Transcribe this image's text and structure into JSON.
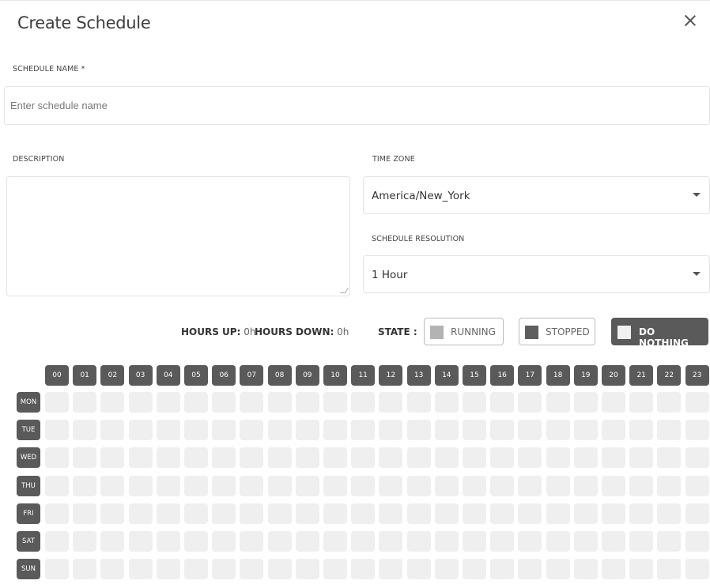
{
  "dialog": {
    "title": "Create Schedule"
  },
  "form": {
    "schedule_name_label": "SCHEDULE NAME *",
    "schedule_name_placeholder": "Enter schedule name",
    "schedule_name_value": "",
    "description_label": "DESCRIPTION",
    "description_value": "",
    "time_zone_label": "TIME ZONE",
    "time_zone_value": "America/New_York",
    "resolution_label": "SCHEDULE RESOLUTION",
    "resolution_value": "1 Hour"
  },
  "summary": {
    "hours_up_label": "HOURS UP:",
    "hours_up_value": "0h",
    "hours_down_label": "HOURS DOWN:",
    "hours_down_value": "0h",
    "state_label": "STATE :"
  },
  "states": {
    "running": "RUNNING",
    "stopped": "STOPPED",
    "do_nothing": "DO NOTHING",
    "selected": "DO NOTHING"
  },
  "grid": {
    "hours": [
      "00",
      "01",
      "02",
      "03",
      "04",
      "05",
      "06",
      "07",
      "08",
      "09",
      "10",
      "11",
      "12",
      "13",
      "14",
      "15",
      "16",
      "17",
      "18",
      "19",
      "20",
      "21",
      "22",
      "23"
    ],
    "days": [
      "MON",
      "TUE",
      "WED",
      "THU",
      "FRI",
      "SAT",
      "SUN"
    ]
  },
  "colors": {
    "dark_cell": "#5a5a5a",
    "empty_cell": "#efefef",
    "running_swatch": "#b3b3b3",
    "stopped_swatch": "#5e5e5e"
  },
  "icons": {
    "close": "close-icon",
    "dropdown": "caret-down-icon"
  }
}
